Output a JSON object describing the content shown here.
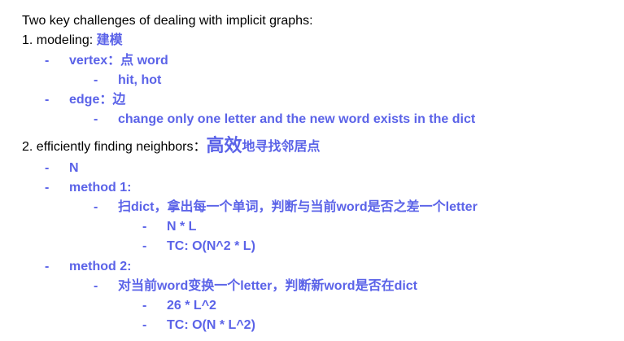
{
  "colors": {
    "accent": "#5b63e8",
    "text": "#000000"
  },
  "heading": "Two key challenges of dealing with implicit graphs:",
  "section1": {
    "label": "1. modeling: ",
    "label_cn": "建模",
    "vertex": {
      "label": "vertex：点 word",
      "child": "hit, hot"
    },
    "edge": {
      "label": "edge：边",
      "child": "change only one letter and the new word exists in the dict"
    }
  },
  "section2": {
    "label": "2. efficiently finding neighbors：",
    "label_big": "高效",
    "label_cn": "地寻找邻居点",
    "n": "N",
    "method1": {
      "label": "method 1:",
      "desc": "扫dict，拿出每一个单词，判断与当前word是否之差一个letter",
      "items": [
        "N * L",
        "TC: O(N^2 * L)"
      ]
    },
    "method2": {
      "label": "method 2:",
      "desc": "对当前word变换一个letter，判断新word是否在dict",
      "items": [
        "26 * L^2",
        "TC: O(N * L^2)"
      ]
    }
  },
  "bullet": "-"
}
